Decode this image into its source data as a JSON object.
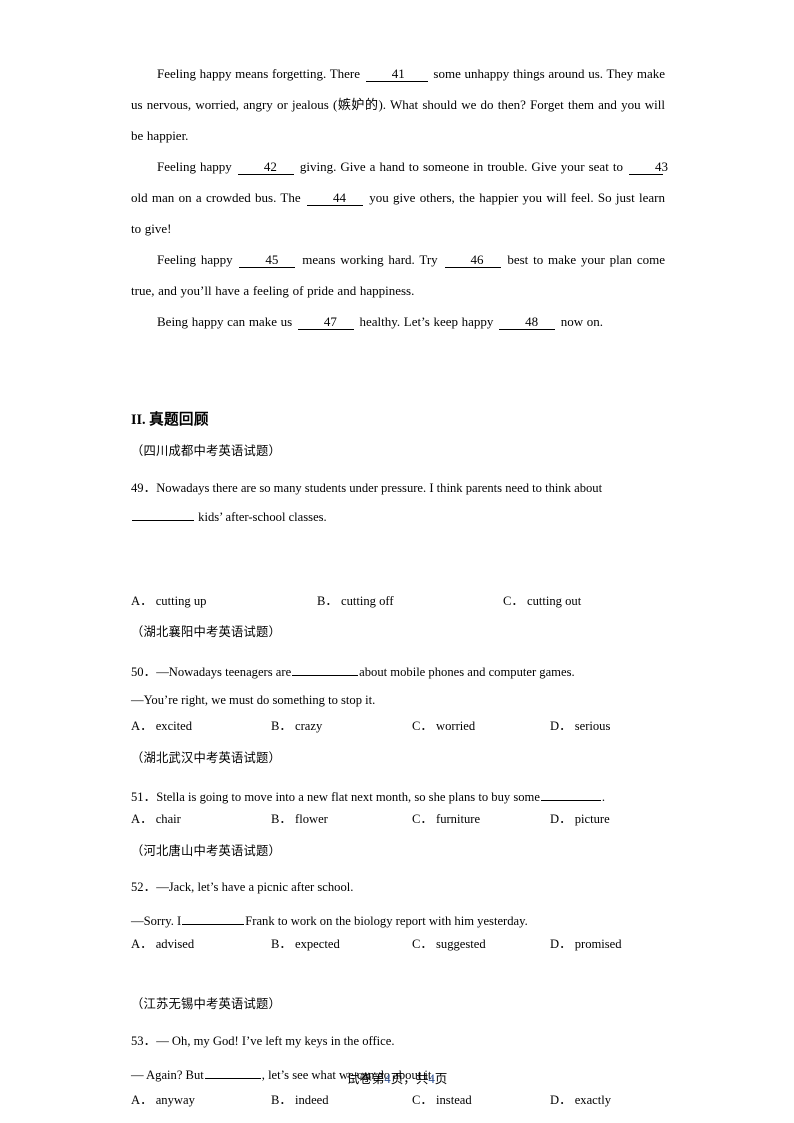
{
  "document": {
    "cloze": {
      "paragraphs": [
        {
          "id": "p1",
          "segments": [
            {
              "type": "text",
              "value": "Feeling happy means forgetting. There "
            },
            {
              "type": "blank",
              "value": "41"
            },
            {
              "type": "text",
              "value": " some unhappy things around us. They make us nervous, worried, angry or jealous (嫉妒的). What should we do then? Forget them and you will be happier."
            }
          ]
        },
        {
          "id": "p2",
          "segments": [
            {
              "type": "text",
              "value": "Feeling happy "
            },
            {
              "type": "blank",
              "value": "42"
            },
            {
              "type": "text",
              "value": " giving. Give a hand to someone in trouble. Give your seat to "
            },
            {
              "type": "blank",
              "value": "43"
            },
            {
              "type": "text",
              "value": " old man on a crowded bus. The "
            },
            {
              "type": "blank",
              "value": "44"
            },
            {
              "type": "text",
              "value": " you give others, the happier you will feel. So just learn to give!"
            }
          ]
        },
        {
          "id": "p3",
          "segments": [
            {
              "type": "text",
              "value": "Feeling happy "
            },
            {
              "type": "blank",
              "value": "45"
            },
            {
              "type": "text",
              "value": " means working hard. Try "
            },
            {
              "type": "blank",
              "value": "46"
            },
            {
              "type": "text",
              "value": " best to make your plan come true, and you’ll have a feeling of pride and happiness."
            }
          ]
        },
        {
          "id": "p4",
          "segments": [
            {
              "type": "text",
              "value": "Being happy can make us "
            },
            {
              "type": "blank",
              "value": "47"
            },
            {
              "type": "text",
              "value": " healthy. Let’s keep happy "
            },
            {
              "type": "blank",
              "value": "48"
            },
            {
              "type": "text",
              "value": " now on."
            }
          ]
        }
      ]
    },
    "section": {
      "number": "II.",
      "title": "真题回顾"
    },
    "questions": [
      {
        "source": "（四川成都中考英语试题）",
        "number": "49．",
        "stem_line1": "Nowadays there are so many students under pressure. I think parents need to think about",
        "stem_line2_pre": "",
        "stem_line2_post": " kids’ after-school classes.",
        "options": [
          {
            "label": "A．",
            "text": "cutting up"
          },
          {
            "label": "B．",
            "text": "cutting off"
          },
          {
            "label": "C．",
            "text": "cutting out"
          }
        ]
      },
      {
        "source": "（湖北襄阳中考英语试题）",
        "number": "50．",
        "stem_pre": "—Nowadays teenagers are",
        "stem_post": "about mobile phones and computer games.",
        "reply": "—You’re right, we must do something to stop it.",
        "options": [
          {
            "label": "A．",
            "text": "excited"
          },
          {
            "label": "B．",
            "text": "crazy"
          },
          {
            "label": "C．",
            "text": "worried"
          },
          {
            "label": "D．",
            "text": "serious"
          }
        ]
      },
      {
        "source": "（湖北武汉中考英语试题）",
        "number": "51．",
        "stem_pre": "Stella is going to move into a new flat next month, so she plans to buy some",
        "stem_post": ".",
        "options": [
          {
            "label": "A．",
            "text": "chair"
          },
          {
            "label": "B．",
            "text": "flower"
          },
          {
            "label": "C．",
            "text": "furniture"
          },
          {
            "label": "D．",
            "text": "picture"
          }
        ]
      },
      {
        "source": "（河北唐山中考英语试题）",
        "number": "52．",
        "stem_line1": "—Jack, let’s have a picnic after school.",
        "reply_pre": "—Sorry. I",
        "reply_post": "Frank to work on the biology report with him yesterday.",
        "options": [
          {
            "label": "A．",
            "text": "advised"
          },
          {
            "label": "B．",
            "text": "expected"
          },
          {
            "label": "C．",
            "text": "suggested"
          },
          {
            "label": "D．",
            "text": "promised"
          }
        ]
      },
      {
        "source": "（江苏无锡中考英语试题）",
        "number": "53．",
        "stem_line1": "— Oh, my God! I’ve left my keys in the office.",
        "reply_pre": "— Again? But",
        "reply_post": ", let’s see what we can do about it.",
        "options": [
          {
            "label": "A．",
            "text": "anyway"
          },
          {
            "label": "B．",
            "text": "indeed"
          },
          {
            "label": "C．",
            "text": "instead"
          },
          {
            "label": "D．",
            "text": "exactly"
          }
        ]
      }
    ],
    "footer": {
      "prefix": "试卷第",
      "current_page": "4",
      "middle": "页，共",
      "total_pages": "4",
      "suffix": "页"
    }
  }
}
